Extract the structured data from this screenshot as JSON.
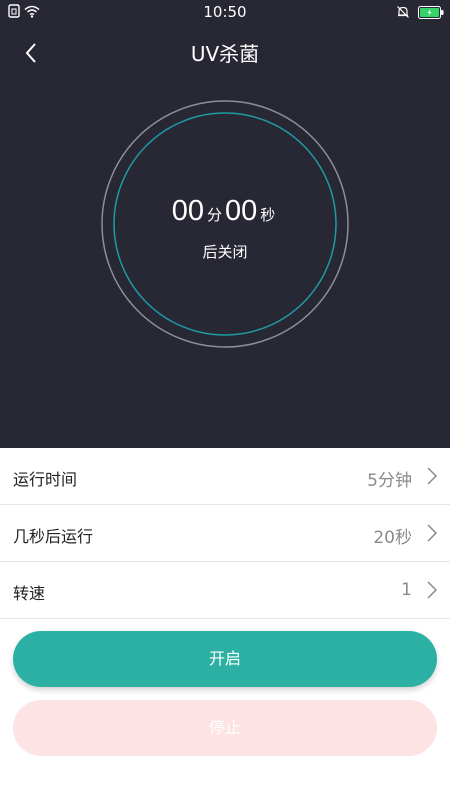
{
  "status_bar": {
    "time": "10:50",
    "icons_left": [
      "sim-icon",
      "wifi-icon"
    ],
    "icons_right": [
      "bell-muted-icon",
      "battery-charging-icon"
    ]
  },
  "header": {
    "title": "UV杀菌",
    "back_icon": "chevron-left-icon"
  },
  "timer": {
    "minutes": "00",
    "minutes_unit": "分",
    "seconds": "00",
    "seconds_unit": "秒",
    "subtitle": "后关闭"
  },
  "settings": [
    {
      "label": "运行时间",
      "value": "5分钟"
    },
    {
      "label": "几秒后运行",
      "value": "20秒"
    },
    {
      "label": "转速",
      "value": "1"
    }
  ],
  "buttons": {
    "start": "开启",
    "stop": "停止"
  },
  "colors": {
    "header_bg": "#272834",
    "accent": "#2db0a4",
    "ring_inner": "#1f9aa6",
    "stop_bg": "#fde3e3"
  }
}
